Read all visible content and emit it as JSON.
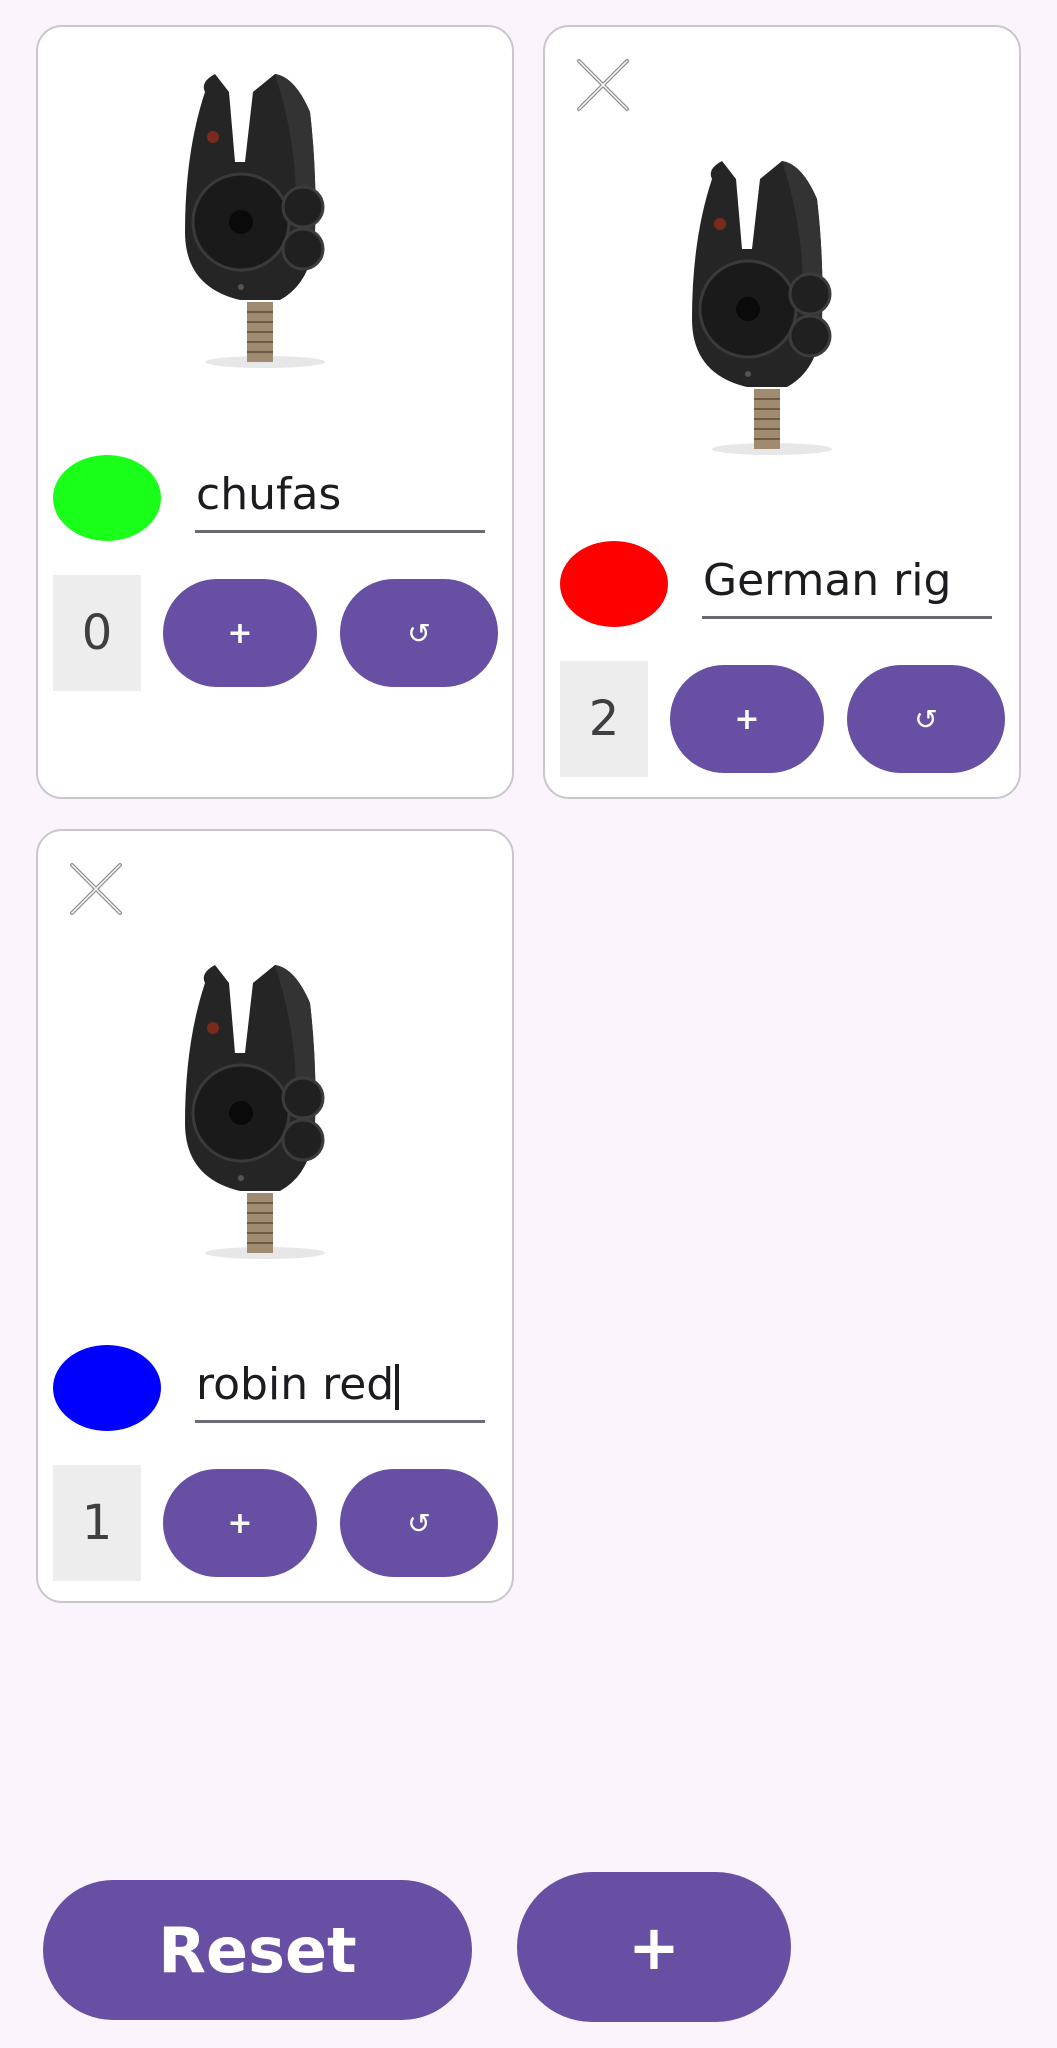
{
  "accent_color": "#6750a4",
  "background_color": "#fcf4fd",
  "cards": [
    {
      "name": "chufas",
      "color": "#1aff1a",
      "count": "0",
      "plus_label": "+",
      "reset_label": "↺",
      "removable": false,
      "focused": false
    },
    {
      "name": "German rig",
      "color": "#ff0000",
      "count": "2",
      "plus_label": "+",
      "reset_label": "↺",
      "removable": true,
      "focused": false
    },
    {
      "name": "robin red",
      "color": "#0000ff",
      "count": "1",
      "plus_label": "+",
      "reset_label": "↺",
      "removable": true,
      "focused": true
    }
  ],
  "footer": {
    "reset_all_label": "Reset",
    "add_card_label": "+"
  },
  "icons": {
    "close": "close-icon",
    "device_image": "bite-alarm-image"
  }
}
